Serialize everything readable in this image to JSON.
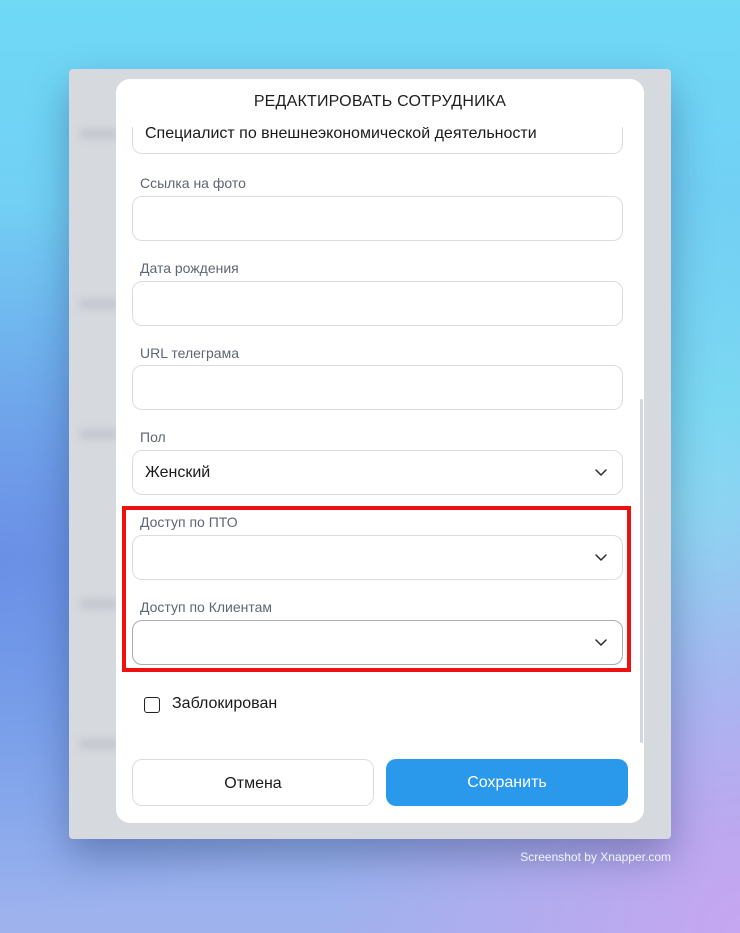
{
  "modal": {
    "title": "РЕДАКТИРОВАТЬ СОТРУДНИКА",
    "position_value": "Специалист по внешнеэкономической деятельности",
    "fields": {
      "photo_label": "Ссылка на фото",
      "photo_value": "",
      "birthdate_label": "Дата рождения",
      "birthdate_value": "",
      "telegram_label": "URL телеграма",
      "telegram_value": "",
      "gender_label": "Пол",
      "gender_value": "Женский",
      "pto_access_label": "Доступ по ПТО",
      "pto_access_value": "",
      "clients_access_label": "Доступ по Клиентам",
      "clients_access_value": ""
    },
    "blocked_label": "Заблокирован",
    "blocked_checked": false,
    "cancel_label": "Отмена",
    "save_label": "Сохранить",
    "icons": {
      "select": "chevron-down-icon"
    },
    "colors": {
      "primary": "#2a99ec",
      "highlight": "#ee1111"
    }
  },
  "credit": "Screenshot by Xnapper.com"
}
